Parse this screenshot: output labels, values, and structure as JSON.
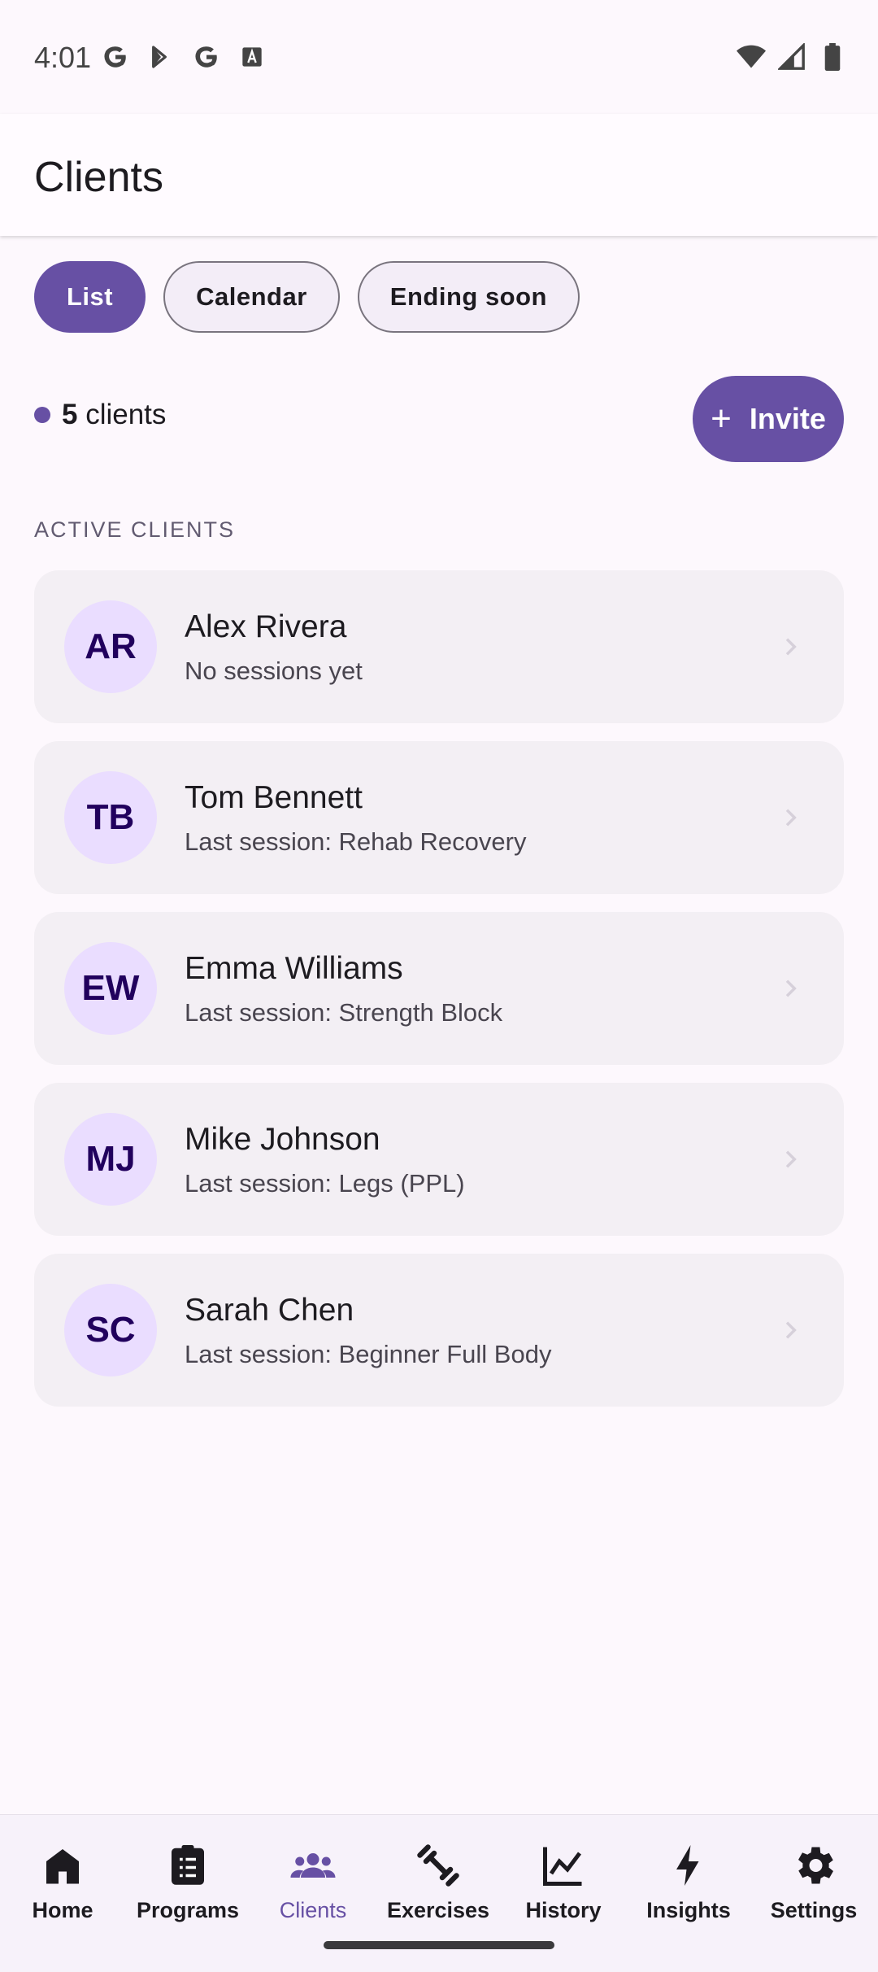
{
  "status_bar": {
    "time": "4:01"
  },
  "app_bar": {
    "title": "Clients"
  },
  "chips": [
    {
      "label": "List",
      "selected": true
    },
    {
      "label": "Calendar",
      "selected": false
    },
    {
      "label": "Ending soon",
      "selected": false
    }
  ],
  "summary": {
    "count": "5",
    "count_suffix": " clients"
  },
  "invite_button": {
    "label": "Invite",
    "icon": "plus-icon"
  },
  "section_label": "ACTIVE CLIENTS",
  "clients": [
    {
      "initials": "AR",
      "name": "Alex Rivera",
      "subtitle": "No sessions yet"
    },
    {
      "initials": "TB",
      "name": "Tom Bennett",
      "subtitle": "Last session: Rehab Recovery"
    },
    {
      "initials": "EW",
      "name": "Emma Williams",
      "subtitle": "Last session: Strength Block"
    },
    {
      "initials": "MJ",
      "name": "Mike Johnson",
      "subtitle": "Last session: Legs (PPL)"
    },
    {
      "initials": "SC",
      "name": "Sarah Chen",
      "subtitle": "Last session: Beginner Full Body"
    }
  ],
  "bottom_nav": [
    {
      "label": "Home",
      "icon": "home-icon",
      "active": false
    },
    {
      "label": "Programs",
      "icon": "clipboard-icon",
      "active": false
    },
    {
      "label": "Clients",
      "icon": "group-icon",
      "active": true
    },
    {
      "label": "Exercises",
      "icon": "dumbbell-icon",
      "active": false
    },
    {
      "label": "History",
      "icon": "line-chart-icon",
      "active": false
    },
    {
      "label": "Insights",
      "icon": "bolt-icon",
      "active": false
    },
    {
      "label": "Settings",
      "icon": "gear-icon",
      "active": false
    }
  ],
  "colors": {
    "primary": "#6750a4",
    "avatar_bg": "#eaddff",
    "avatar_text": "#21005d",
    "card_bg": "#f3eff4"
  }
}
